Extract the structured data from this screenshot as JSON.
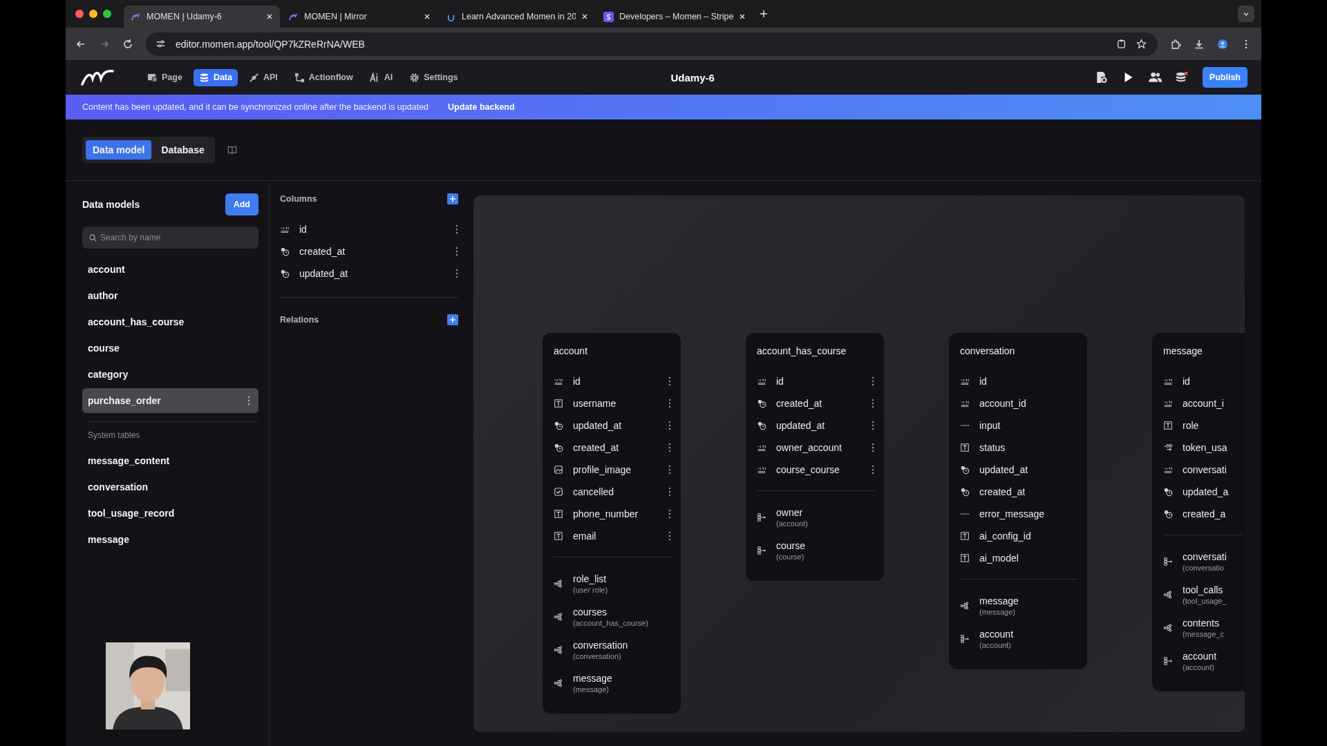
{
  "browser": {
    "tabs": [
      {
        "title": "MOMEN | Udamy-6",
        "selected": true
      },
      {
        "title": "MOMEN | Mirror",
        "selected": false
      },
      {
        "title": "Learn Advanced Momen in 20",
        "selected": false
      },
      {
        "title": "Developers – Momen – Stripe",
        "selected": false
      }
    ],
    "url": "editor.momen.app/tool/QP7kZReRrNA/WEB"
  },
  "toolbar": {
    "nav": [
      {
        "label": "Page",
        "selected": false
      },
      {
        "label": "Data",
        "selected": true
      },
      {
        "label": "API",
        "selected": false
      },
      {
        "label": "Actionflow",
        "selected": false
      },
      {
        "label": "AI",
        "selected": false
      },
      {
        "label": "Settings",
        "selected": false
      }
    ],
    "title": "Udamy-6",
    "publish": "Publish"
  },
  "banner": {
    "message": "Content has been updated, and it can be synchronized online after the backend is updated",
    "action": "Update backend"
  },
  "view_tabs": [
    {
      "label": "Data model",
      "selected": true
    },
    {
      "label": "Database",
      "selected": false
    }
  ],
  "sidebar": {
    "title": "Data models",
    "add": "Add",
    "search": {
      "placeholder": "Search by name"
    },
    "models": [
      {
        "label": "account",
        "selected": false
      },
      {
        "label": "author",
        "selected": false
      },
      {
        "label": "account_has_course",
        "selected": false
      },
      {
        "label": "course",
        "selected": false
      },
      {
        "label": "category",
        "selected": false
      },
      {
        "label": "purchase_order",
        "selected": true
      }
    ],
    "system_title": "System tables",
    "system_models": [
      {
        "label": "message_content",
        "selected": false
      },
      {
        "label": "conversation",
        "selected": false
      },
      {
        "label": "tool_usage_record",
        "selected": false
      },
      {
        "label": "message",
        "selected": false
      }
    ]
  },
  "columns_panel": {
    "columns_title": "Columns",
    "columns": [
      {
        "name": "id",
        "kind": "number"
      },
      {
        "name": "created_at",
        "kind": "datetime"
      },
      {
        "name": "updated_at",
        "kind": "datetime"
      }
    ],
    "relations_title": "Relations"
  },
  "diagram": {
    "cards": [
      {
        "title": "account",
        "menus": true,
        "cut": false,
        "fields": [
          {
            "name": "id",
            "kind": "number"
          },
          {
            "name": "username",
            "kind": "text"
          },
          {
            "name": "updated_at",
            "kind": "datetime"
          },
          {
            "name": "created_at",
            "kind": "datetime"
          },
          {
            "name": "profile_image",
            "kind": "image"
          },
          {
            "name": "cancelled",
            "kind": "boolean"
          },
          {
            "name": "phone_number",
            "kind": "text"
          },
          {
            "name": "email",
            "kind": "text"
          }
        ],
        "relations": [
          {
            "name": "role_list",
            "target": "(user role)",
            "kind": "many"
          },
          {
            "name": "courses",
            "target": "(account_has_course)",
            "kind": "many"
          },
          {
            "name": "conversation",
            "target": "(conversation)",
            "kind": "many"
          },
          {
            "name": "message",
            "target": "(message)",
            "kind": "many"
          }
        ]
      },
      {
        "title": "account_has_course",
        "menus": true,
        "cut": false,
        "fields": [
          {
            "name": "id",
            "kind": "number"
          },
          {
            "name": "created_at",
            "kind": "datetime"
          },
          {
            "name": "updated_at",
            "kind": "datetime"
          },
          {
            "name": "owner_account",
            "kind": "number"
          },
          {
            "name": "course_course",
            "kind": "number"
          }
        ],
        "relations": [
          {
            "name": "owner",
            "target": "(account)",
            "kind": "one"
          },
          {
            "name": "course",
            "target": "(course)",
            "kind": "one"
          }
        ]
      },
      {
        "title": "conversation",
        "menus": false,
        "cut": false,
        "fields": [
          {
            "name": "id",
            "kind": "number"
          },
          {
            "name": "account_id",
            "kind": "number"
          },
          {
            "name": "input",
            "kind": "json"
          },
          {
            "name": "status",
            "kind": "text"
          },
          {
            "name": "updated_at",
            "kind": "datetime"
          },
          {
            "name": "created_at",
            "kind": "datetime"
          },
          {
            "name": "error_message",
            "kind": "json"
          },
          {
            "name": "ai_config_id",
            "kind": "text"
          },
          {
            "name": "ai_model",
            "kind": "text"
          }
        ],
        "relations": [
          {
            "name": "message",
            "target": "(message)",
            "kind": "many"
          },
          {
            "name": "account",
            "target": "(account)",
            "kind": "one"
          }
        ]
      },
      {
        "title": "message",
        "menus": false,
        "cut": true,
        "fields": [
          {
            "name": "id",
            "kind": "number"
          },
          {
            "name": "account_i",
            "kind": "number"
          },
          {
            "name": "role",
            "kind": "text"
          },
          {
            "name": "token_usa",
            "kind": "decimal"
          },
          {
            "name": "conversati",
            "kind": "number"
          },
          {
            "name": "updated_a",
            "kind": "datetime"
          },
          {
            "name": "created_a",
            "kind": "datetime"
          }
        ],
        "relations": [
          {
            "name": "conversati",
            "target": "(conversatio",
            "kind": "one"
          },
          {
            "name": "tool_calls",
            "target": "(tool_usage_",
            "kind": "many"
          },
          {
            "name": "contents",
            "target": "(message_c",
            "kind": "many"
          },
          {
            "name": "account",
            "target": "(account)",
            "kind": "one"
          }
        ]
      }
    ]
  }
}
